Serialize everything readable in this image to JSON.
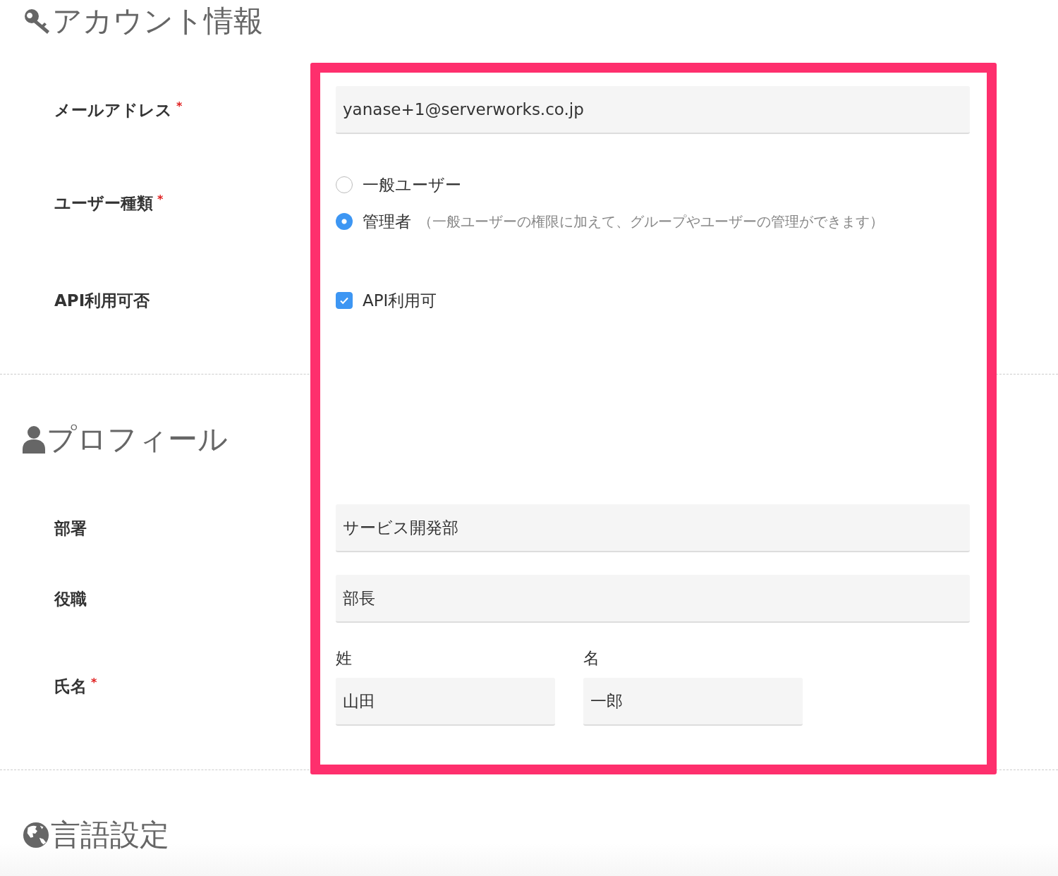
{
  "highlight_frame": true,
  "sections": [
    {
      "title": "アカウント情報",
      "fields": [
        {
          "kind": "text",
          "label": "メールアドレス",
          "required": "*",
          "value": "yanase+1@serverworks.co.jp"
        },
        {
          "kind": "radio",
          "label": "ユーザー種類",
          "required": "*",
          "options": [
            {
              "label": "一般ユーザー",
              "selected": false
            },
            {
              "label": "管理者",
              "hint": "（一般ユーザーの権限に加えて、グループやユーザーの管理ができます）",
              "selected": true
            }
          ]
        },
        {
          "kind": "checkbox",
          "label": "API利用可否",
          "option": {
            "label": "API利用可",
            "checked": true
          }
        }
      ]
    },
    {
      "title": "プロフィール",
      "fields": [
        {
          "kind": "text",
          "label": "部署",
          "value": "サービス開発部"
        },
        {
          "kind": "text",
          "label": "役職",
          "value": "部長"
        },
        {
          "kind": "name",
          "label": "氏名",
          "required": "*",
          "parts": [
            {
              "label": "姓",
              "value": "山田"
            },
            {
              "label": "名",
              "value": "一郎"
            }
          ]
        }
      ]
    },
    {
      "title": "言語設定"
    }
  ]
}
